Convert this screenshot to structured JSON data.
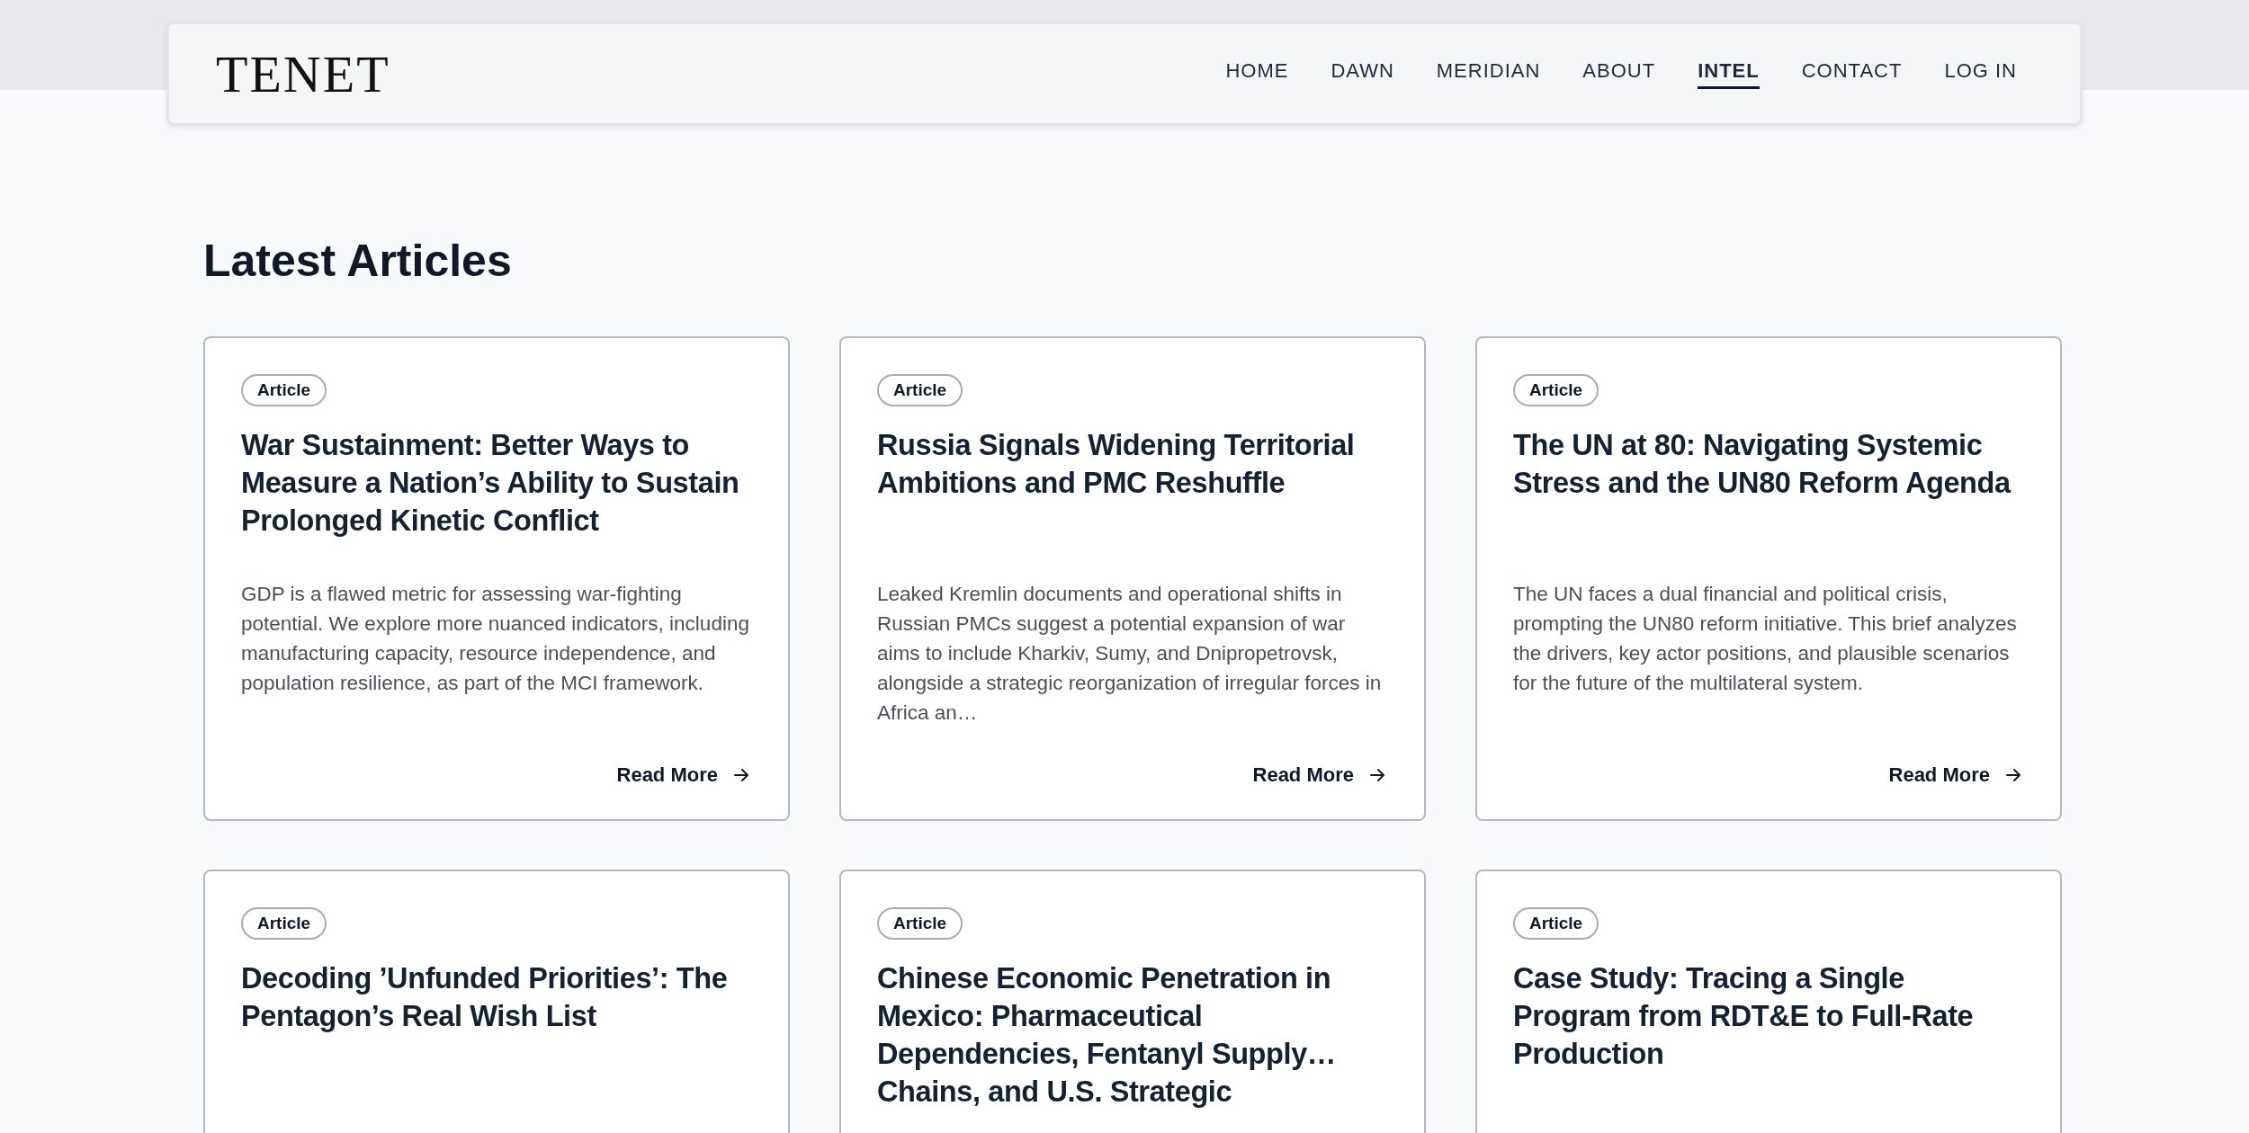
{
  "header": {
    "logo": "TENET",
    "nav": [
      {
        "label": "HOME",
        "selected": false
      },
      {
        "label": "DAWN",
        "selected": false
      },
      {
        "label": "MERIDIAN",
        "selected": false
      },
      {
        "label": "ABOUT",
        "selected": false
      },
      {
        "label": "INTEL",
        "selected": true
      },
      {
        "label": "CONTACT",
        "selected": false
      },
      {
        "label": "LOG IN",
        "selected": false
      }
    ]
  },
  "heading": "Latest Articles",
  "articles": [
    {
      "badge": "Article",
      "title": "War Sustainment: Better Ways to Measure a Nation’s Ability to Sustain Prolonged Kinetic Conflict",
      "description": "GDP is a flawed metric for assessing war-fighting potential. We explore more nuanced indicators, including manufacturing capacity, resource independence, and population resilience, as part of the MCI framework.",
      "link": "Read More"
    },
    {
      "badge": "Article",
      "title": "Russia Signals Widening Territorial Ambitions and PMC Reshuffle",
      "description": "Leaked Kremlin documents and operational shifts in Russian PMCs suggest a potential expansion of war aims to include Kharkiv, Sumy, and Dnipropetrovsk, alongside a strategic reorganization of irregular forces in Africa an…",
      "link": "Read More"
    },
    {
      "badge": "Article",
      "title": "The UN at 80: Navigating Systemic Stress and the UN80 Reform Agenda",
      "description": "The UN faces a dual financial and political crisis, prompting the UN80 reform initiative. This brief analyzes the drivers, key actor positions, and plausible scenarios for the future of the multilateral system.",
      "link": "Read More"
    },
    {
      "badge": "Article",
      "title": "Decoding ’Unfunded Priorities’: The Pentagon’s Real Wish List"
    },
    {
      "badge": "Article",
      "title": "Chinese Economic Penetration in Mexico: Pharmaceutical Dependencies, Fentanyl Supply… Chains, and U.S. Strategic"
    },
    {
      "badge": "Article",
      "title": "Case Study: Tracing a Single Program from RDT&E to Full-Rate Production"
    }
  ]
}
